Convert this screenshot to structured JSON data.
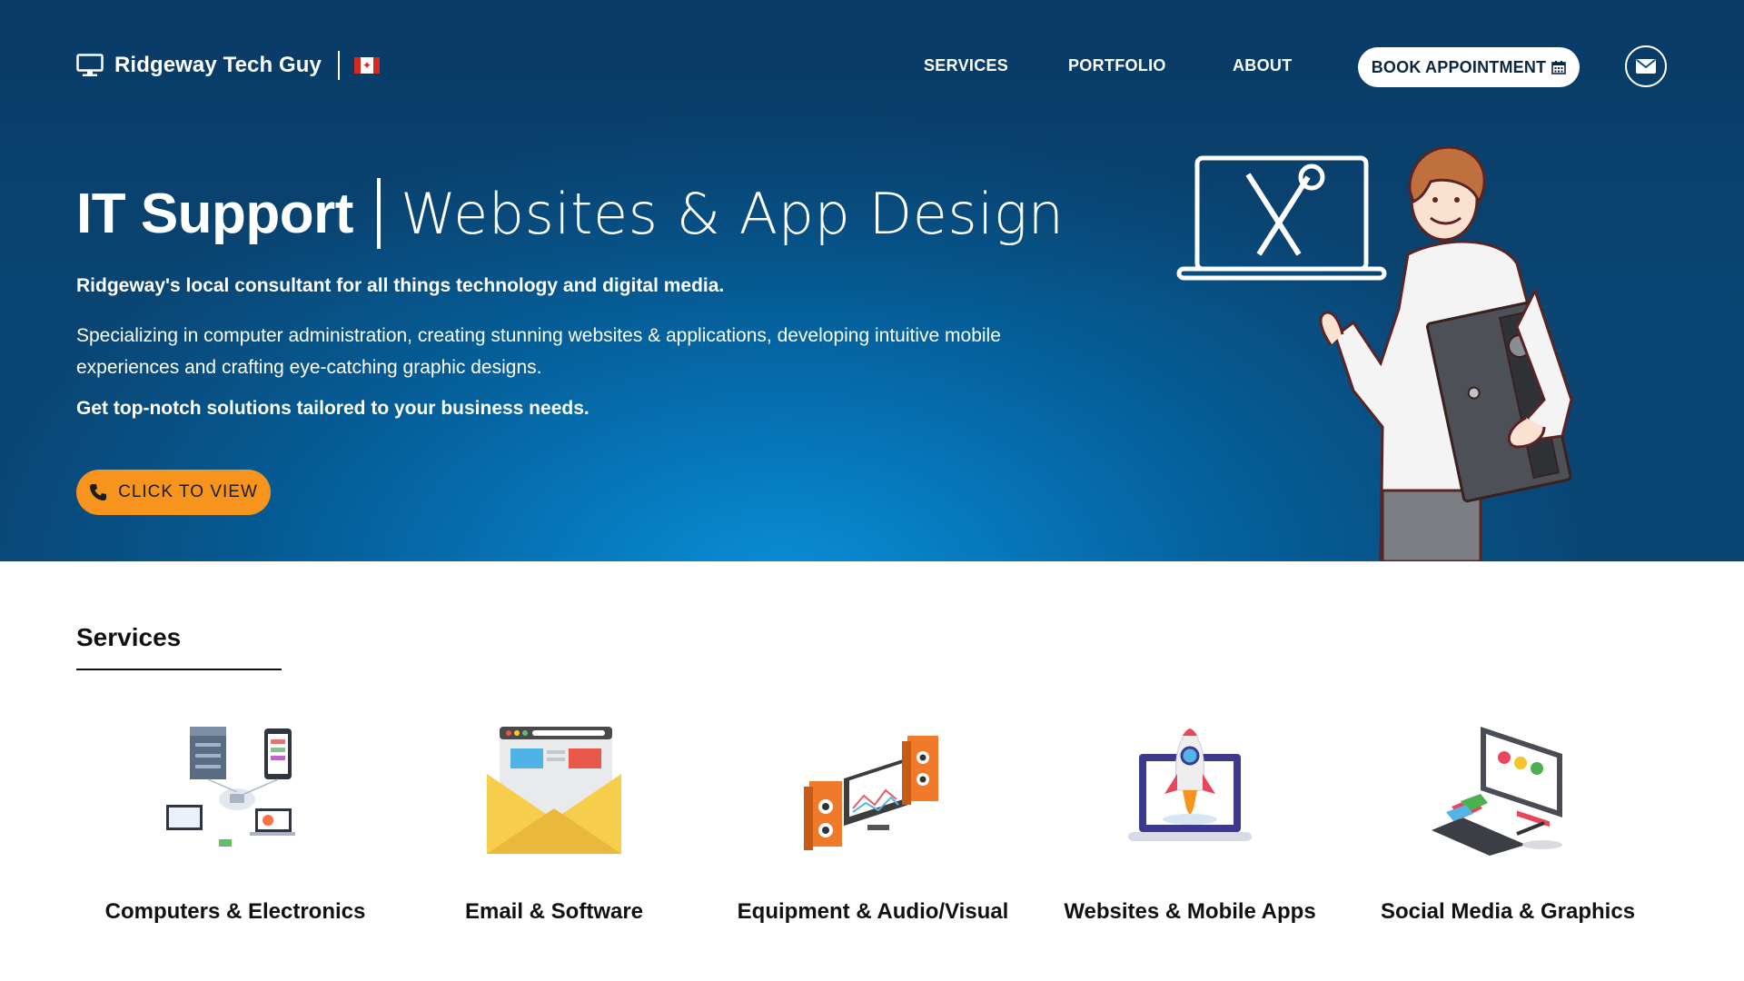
{
  "brand": {
    "name": "Ridgeway Tech Guy",
    "icon": "monitor-icon",
    "flag": "canada-flag-icon"
  },
  "nav": {
    "items": [
      {
        "label": "SERVICES"
      },
      {
        "label": "PORTFOLIO"
      },
      {
        "label": "ABOUT"
      }
    ],
    "book_label": "BOOK APPOINTMENT",
    "book_icon": "calendar-icon",
    "mail_icon": "envelope-icon"
  },
  "hero": {
    "title_strong": "IT Support",
    "title_light": "Websites & App Design",
    "p1": "Ridgeway's local consultant for all things technology and digital media.",
    "p2": "Specializing in computer administration, creating stunning websites & applications, developing intuitive mobile experiences and crafting eye-catching graphic designs.",
    "p3": "Get top-notch solutions tailored to your business needs.",
    "cta_label": "CLICK TO VIEW",
    "cta_icon": "phone-icon"
  },
  "services": {
    "title": "Services",
    "items": [
      {
        "label": "Computers & Electronics",
        "icon": "devices-network-icon"
      },
      {
        "label": "Email & Software",
        "icon": "email-envelope-icon"
      },
      {
        "label": "Equipment & Audio/Visual",
        "icon": "speakers-monitor-icon"
      },
      {
        "label": "Websites & Mobile Apps",
        "icon": "rocket-laptop-icon"
      },
      {
        "label": "Social Media & Graphics",
        "icon": "graphics-tablet-icon"
      }
    ]
  },
  "colors": {
    "hero_dark": "#0a4573",
    "hero_light": "#0a8ed6",
    "cta": "#f7941d",
    "text_dark": "#111111"
  }
}
